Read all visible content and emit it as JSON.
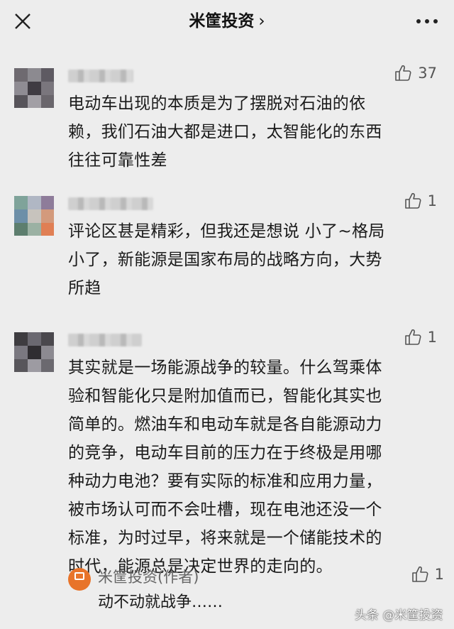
{
  "header": {
    "title": "米筐投资",
    "chevron": "›",
    "close_icon": "close-icon",
    "more_icon": "more-icon"
  },
  "comments": [
    {
      "likes": "37",
      "lines": [
        "电动车出现的本质是为了摆脱对石油的依",
        "赖，我们石油大都是进口，太智能化的东西",
        "往往可靠性差"
      ]
    },
    {
      "likes": "1",
      "lines": [
        "评论区甚是精彩，但我还是想说 小了~格局",
        "小了，新能源是国家布局的战略方向，大势",
        "所趋"
      ]
    },
    {
      "likes": "1",
      "lines": [
        "其实就是一场能源战争的较量。什么驾乘体",
        "验和智能化只是附加值而已，智能化其实也",
        "简单的。燃油车和电动车就是各自能源动力",
        "的竞争，电动车目前的压力在于终极是用哪",
        "种动力电池？要有实际的标准和应用力量，",
        "被市场认可而不会吐槽，现在电池还没一个",
        "标准，为时过早，将来就是一个储能技术的",
        "时代，能源总是决定世界的走向的。"
      ],
      "reply": {
        "author": "米筐投资(作者)",
        "text": "动不动就战争……",
        "likes": "1"
      }
    }
  ],
  "watermark": "头条 @米筐投资",
  "colors": {
    "background": "#ededed",
    "reply_avatar": "#e8742a"
  }
}
